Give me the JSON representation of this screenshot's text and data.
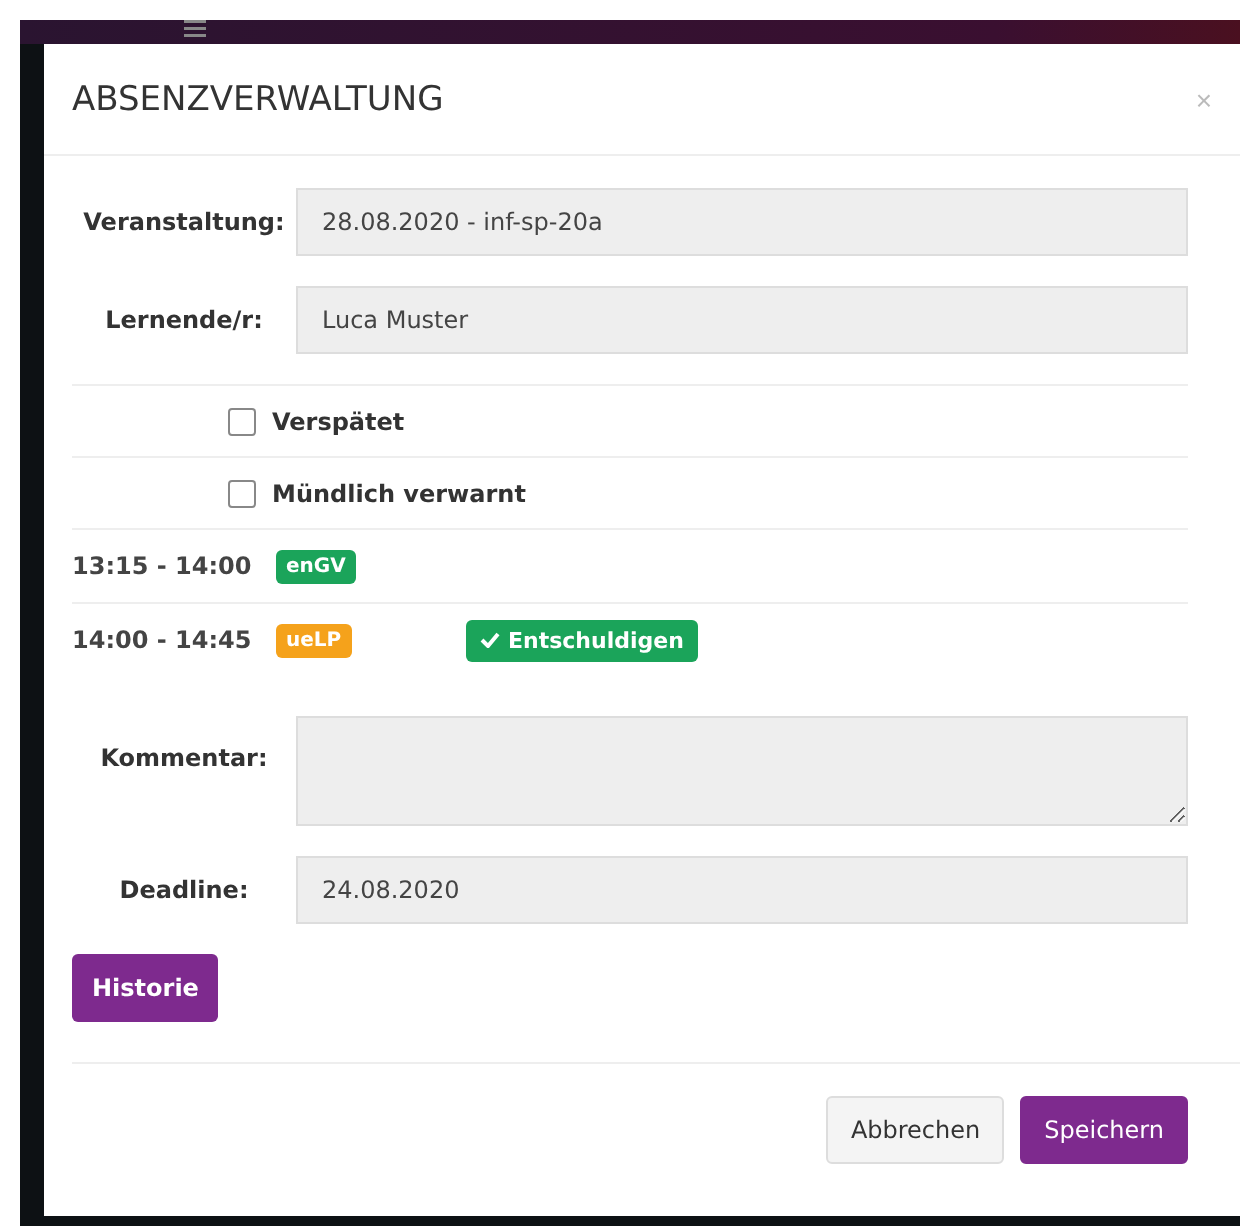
{
  "modal": {
    "title": "ABSENZVERWALTUNG",
    "close": "×"
  },
  "fields": [
    {
      "kind": "input",
      "label": "Veranstaltung:",
      "value": "28.08.2020 - inf-sp-20a"
    },
    {
      "kind": "input",
      "label": "Lernende/r:",
      "value": "Luca Muster"
    }
  ],
  "checkboxes": [
    {
      "label": "Verspätet",
      "checked": false
    },
    {
      "label": "Mündlich verwarnt",
      "checked": false
    }
  ],
  "lessons": [
    {
      "time": "13:15 - 14:00",
      "code": "enGV",
      "color": "#1ba45a"
    },
    {
      "time": "14:00 - 14:45",
      "code": "ueLP",
      "color": "#f5a21b",
      "action": "Entschuldigen"
    }
  ],
  "extra_fields": [
    {
      "kind": "textarea",
      "label": "Kommentar:"
    },
    {
      "kind": "input",
      "label": "Deadline:",
      "value": "24.08.2020"
    }
  ],
  "history_button": "Historie",
  "footer": {
    "buttons": [
      {
        "label": "Abbrechen",
        "kind": "default"
      },
      {
        "label": "Speichern",
        "kind": "primary"
      }
    ]
  }
}
